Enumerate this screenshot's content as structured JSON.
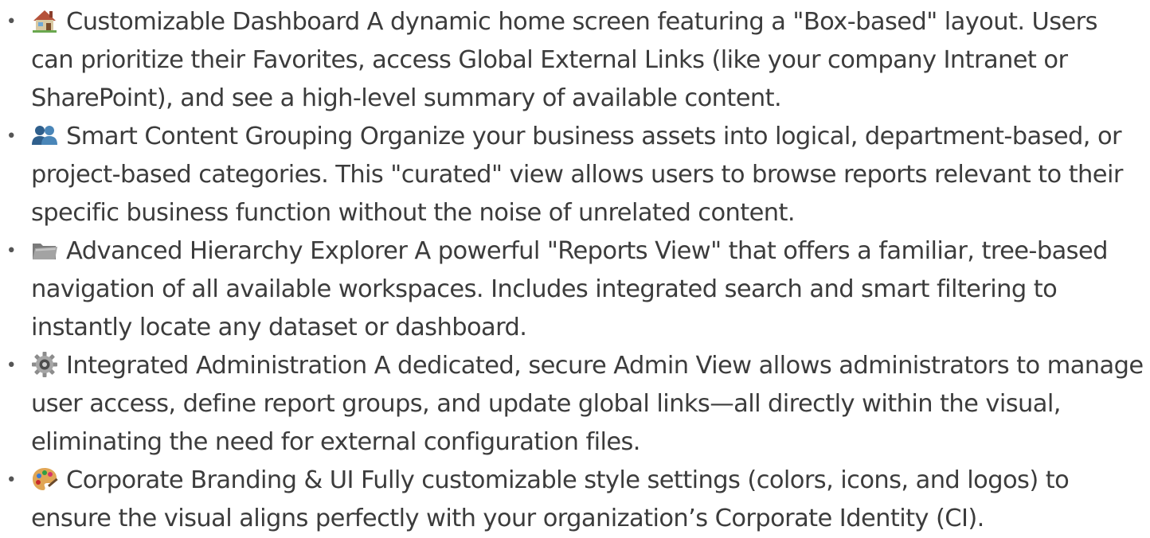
{
  "features": [
    {
      "icon": "house-icon",
      "text": "Customizable Dashboard A dynamic home screen featuring a \"Box-based\" layout. Users can prioritize their Favorites, access Global External Links (like your company Intranet or SharePoint), and see a high-level summary of available content."
    },
    {
      "icon": "people-icon",
      "text": "Smart Content Grouping Organize your business assets into logical, department-based, or project-based categories. This \"curated\" view allows users to browse reports relevant to their specific business function without the noise of unrelated content."
    },
    {
      "icon": "folder-icon",
      "text": "Advanced Hierarchy Explorer A powerful \"Reports View\" that offers a familiar, tree-based navigation of all available workspaces. Includes integrated search and smart filtering to instantly locate any dataset or dashboard."
    },
    {
      "icon": "gear-icon",
      "text": "Integrated Administration A dedicated, secure Admin View allows administrators to manage user access, define report groups, and update global links—all directly within the visual, eliminating the need for external configuration files."
    },
    {
      "icon": "palette-icon",
      "text": "Corporate Branding & UI Fully customizable style settings (colors, icons, and logos) to ensure the visual aligns perfectly with your organization’s Corporate Identity (CI)."
    }
  ]
}
